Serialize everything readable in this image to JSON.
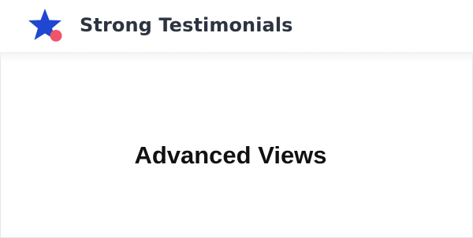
{
  "header": {
    "brand_name": "Strong Testimonials",
    "logo_icon": "star-with-dot-icon",
    "colors": {
      "star": "#1f47d1",
      "dot": "#f0546a",
      "brand_text": "#2c3440"
    }
  },
  "main": {
    "heading": "Advanced Views"
  }
}
